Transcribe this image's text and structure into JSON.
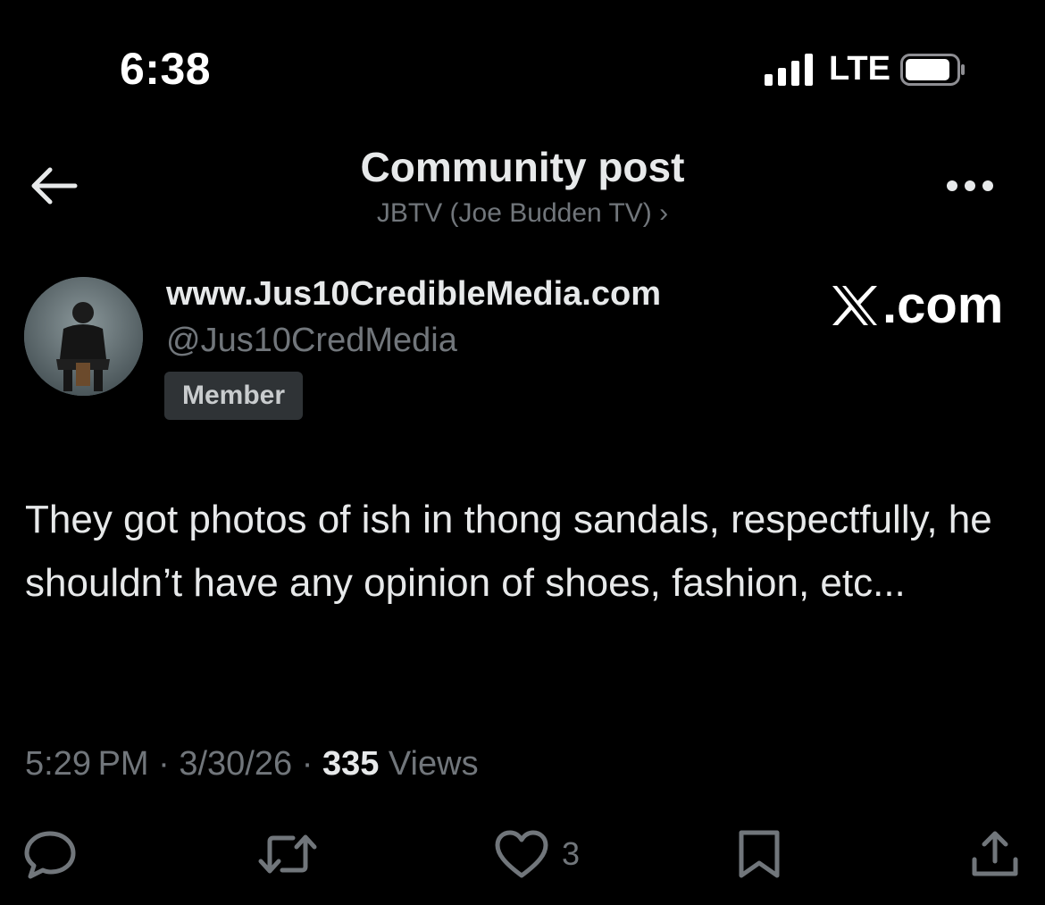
{
  "status_bar": {
    "time": "6:38",
    "network": "LTE"
  },
  "header": {
    "title": "Community post",
    "community": "JBTV (Joe Budden TV) ›"
  },
  "author": {
    "display_name": "www.Jus10CredibleMedia.com",
    "handle": "@Jus10CredMedia",
    "badge": "Member"
  },
  "watermark": {
    "text": ".com"
  },
  "post": {
    "text": "They got photos of ish in thong sandals, respectfully, he shouldn’t have any opinion of shoes, fashion, etc..."
  },
  "meta": {
    "time": "5:29 PM",
    "separator": " · ",
    "date": "3/30/26",
    "views_count": "335",
    "views_label": " Views"
  },
  "actions": {
    "like_count": "3"
  },
  "icons": {
    "back": "arrow-left-icon",
    "more": "more-horizontal-icon",
    "reply": "reply-icon",
    "repost": "repost-icon",
    "like": "heart-icon",
    "bookmark": "bookmark-icon",
    "share": "share-icon"
  },
  "colors": {
    "background": "#000000",
    "primary_text": "#e7e9ea",
    "secondary_text": "#71767b",
    "badge_bg": "#2f3336"
  }
}
